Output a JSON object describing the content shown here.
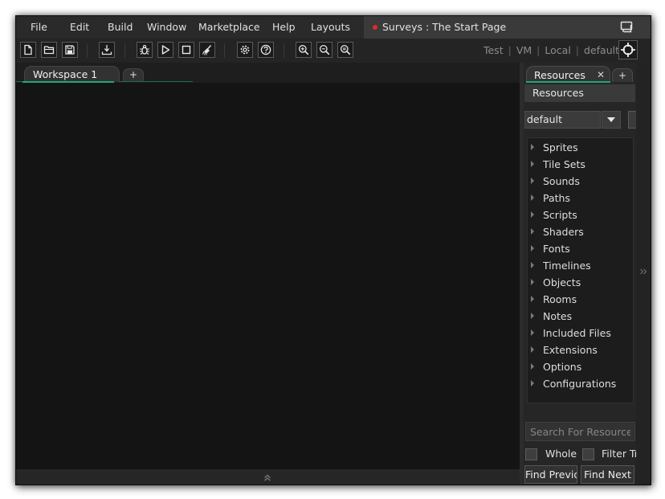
{
  "menu": {
    "items": [
      {
        "label": "File",
        "key": "file"
      },
      {
        "label": "Edit",
        "key": "edit"
      },
      {
        "label": "Build",
        "key": "build"
      },
      {
        "label": "Window",
        "key": "window"
      },
      {
        "label": "Marketplace",
        "key": "marketplace"
      },
      {
        "label": "Help",
        "key": "help"
      },
      {
        "label": "Layouts",
        "key": "layouts"
      }
    ]
  },
  "title": {
    "text": "Surveys : The Start Page",
    "dot_color": "#e02a2a"
  },
  "toolbar": {
    "buttons": [
      {
        "icon": "new-file-icon"
      },
      {
        "icon": "open-folder-icon"
      },
      {
        "icon": "save-icon"
      },
      {
        "icon": "export-icon"
      },
      {
        "icon": "debug-bug-icon"
      },
      {
        "icon": "play-icon"
      },
      {
        "icon": "stop-icon"
      },
      {
        "icon": "clean-broom-icon"
      },
      {
        "icon": "settings-gear-icon"
      },
      {
        "icon": "help-icon"
      },
      {
        "icon": "zoom-in-icon"
      },
      {
        "icon": "zoom-out-icon"
      },
      {
        "icon": "zoom-reset-icon"
      }
    ],
    "target": {
      "config": "Test",
      "platform": "VM",
      "device": "Local",
      "profile": "default",
      "separator": "|"
    },
    "target_button_icon": "crosshair-icon"
  },
  "workspace": {
    "tab_label": "Workspace 1",
    "add_tab_label": "+",
    "accent": "#1fa876",
    "expand_icon": "double-chevron-up-icon"
  },
  "resources": {
    "tab_label": "Resources",
    "tab_close": "✕",
    "add_tab_label": "+",
    "header": "Resources",
    "filter_value": "default",
    "tree": [
      {
        "label": "Sprites"
      },
      {
        "label": "Tile Sets"
      },
      {
        "label": "Sounds"
      },
      {
        "label": "Paths"
      },
      {
        "label": "Scripts"
      },
      {
        "label": "Shaders"
      },
      {
        "label": "Fonts"
      },
      {
        "label": "Timelines"
      },
      {
        "label": "Objects"
      },
      {
        "label": "Rooms"
      },
      {
        "label": "Notes"
      },
      {
        "label": "Included Files"
      },
      {
        "label": "Extensions"
      },
      {
        "label": "Options"
      },
      {
        "label": "Configurations"
      }
    ],
    "search_placeholder": "Search For Resources...",
    "whole_word_label": "Whole Word",
    "filter_tree_label": "Filter Tree",
    "find_previous_label": "Find Previous",
    "find_next_label": "Find Next",
    "collapse_icon": "double-chevron-right-icon"
  }
}
